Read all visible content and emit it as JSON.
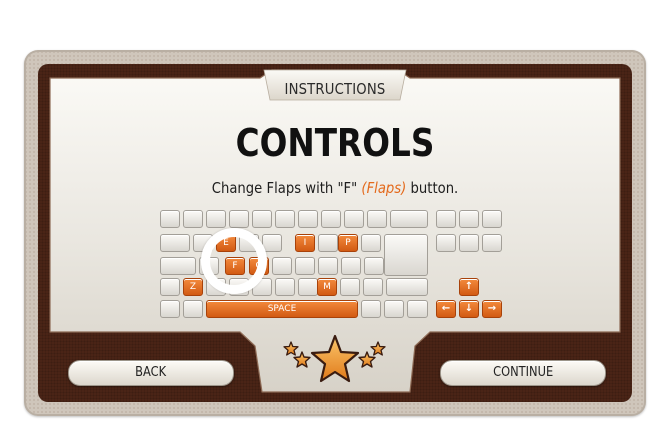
{
  "header": {
    "title": "INSTRUCTIONS"
  },
  "main": {
    "heading": "CONTROLS",
    "subtitle_pre": "Change Flaps with \"F\" ",
    "subtitle_accent": "(Flaps)",
    "subtitle_post": " button."
  },
  "keyboard": {
    "keys": {
      "e": "E",
      "i": "I",
      "p": "P",
      "f": "F",
      "g": "G",
      "z": "Z",
      "m": "M",
      "space": "SPACE",
      "up": "↑",
      "left": "←",
      "down": "↓",
      "right": "→"
    }
  },
  "footer": {
    "back_label": "BACK",
    "continue_label": "CONTINUE"
  },
  "colors": {
    "accent": "#e46a1c",
    "frame_dark": "#4a2416",
    "key_orange": "#e2722a",
    "star_gold": "#f1a03a"
  },
  "icons": {
    "rating": "star-icon"
  }
}
